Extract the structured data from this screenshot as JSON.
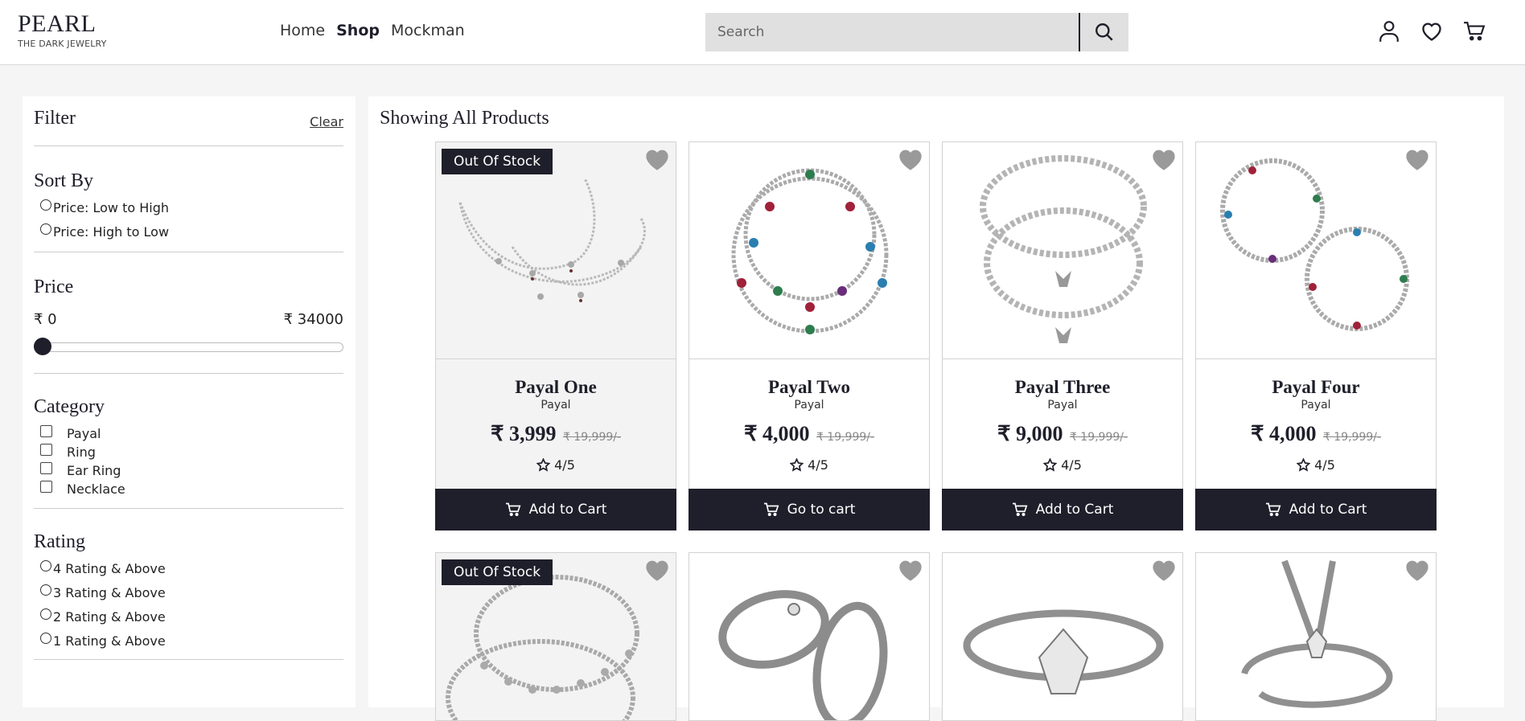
{
  "header": {
    "logo_main": "PEARL",
    "logo_sub": "THE DARK JEWELRY",
    "nav": [
      {
        "label": "Home",
        "active": false
      },
      {
        "label": "Shop",
        "active": true
      },
      {
        "label": "Mockman",
        "active": false
      }
    ],
    "search_placeholder": "Search",
    "icons": [
      "user-icon",
      "heart-icon",
      "cart-icon"
    ]
  },
  "filter": {
    "title": "Filter",
    "clear_label": "Clear",
    "sort": {
      "title": "Sort By",
      "options": [
        "Price: Low to High",
        "Price: High to Low"
      ]
    },
    "price": {
      "title": "Price",
      "min_label": "₹ 0",
      "max_label": "₹ 34000",
      "value_fraction": 0
    },
    "category": {
      "title": "Category",
      "options": [
        "Payal",
        "Ring",
        "Ear Ring",
        "Necklace"
      ]
    },
    "rating": {
      "title": "Rating",
      "options": [
        "4 Rating & Above",
        "3 Rating & Above",
        "2 Rating & Above",
        "1 Rating & Above"
      ]
    }
  },
  "products": {
    "title": "Showing All Products",
    "out_of_stock_label": "Out Of Stock",
    "items": [
      {
        "name": "Payal One",
        "category": "Payal",
        "price": "₹ 3,999",
        "old_price": "₹ 19,999/-",
        "rating": "4/5",
        "button": "Add to Cart",
        "out_of_stock": true
      },
      {
        "name": "Payal Two",
        "category": "Payal",
        "price": "₹ 4,000",
        "old_price": "₹ 19,999/-",
        "rating": "4/5",
        "button": "Go to cart",
        "out_of_stock": false
      },
      {
        "name": "Payal Three",
        "category": "Payal",
        "price": "₹ 9,000",
        "old_price": "₹ 19,999/-",
        "rating": "4/5",
        "button": "Add to Cart",
        "out_of_stock": false
      },
      {
        "name": "Payal Four",
        "category": "Payal",
        "price": "₹ 4,000",
        "old_price": "₹ 19,999/-",
        "rating": "4/5",
        "button": "Add to Cart",
        "out_of_stock": false
      }
    ],
    "row2": [
      {
        "image": "anklet-image",
        "out_of_stock": true
      },
      {
        "image": "couple-rings-image",
        "out_of_stock": false
      },
      {
        "image": "solitaire-ring-image",
        "out_of_stock": false
      },
      {
        "image": "letter-ring-image",
        "out_of_stock": false
      }
    ]
  },
  "colors": {
    "accent": "#1f1f2b",
    "heart": "#9a9a9a"
  }
}
